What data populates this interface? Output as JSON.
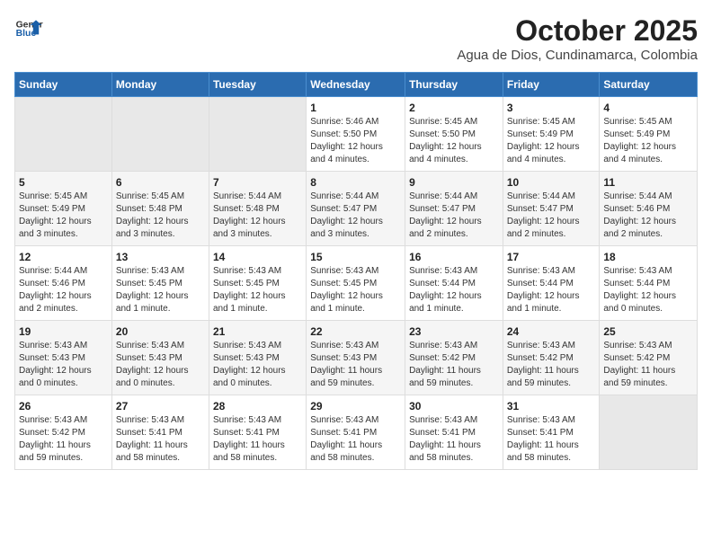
{
  "logo": {
    "general": "General",
    "blue": "Blue"
  },
  "title": "October 2025",
  "subtitle": "Agua de Dios, Cundinamarca, Colombia",
  "weekdays": [
    "Sunday",
    "Monday",
    "Tuesday",
    "Wednesday",
    "Thursday",
    "Friday",
    "Saturday"
  ],
  "weeks": [
    [
      {
        "day": "",
        "info": ""
      },
      {
        "day": "",
        "info": ""
      },
      {
        "day": "",
        "info": ""
      },
      {
        "day": "1",
        "info": "Sunrise: 5:46 AM\nSunset: 5:50 PM\nDaylight: 12 hours\nand 4 minutes."
      },
      {
        "day": "2",
        "info": "Sunrise: 5:45 AM\nSunset: 5:50 PM\nDaylight: 12 hours\nand 4 minutes."
      },
      {
        "day": "3",
        "info": "Sunrise: 5:45 AM\nSunset: 5:49 PM\nDaylight: 12 hours\nand 4 minutes."
      },
      {
        "day": "4",
        "info": "Sunrise: 5:45 AM\nSunset: 5:49 PM\nDaylight: 12 hours\nand 4 minutes."
      }
    ],
    [
      {
        "day": "5",
        "info": "Sunrise: 5:45 AM\nSunset: 5:49 PM\nDaylight: 12 hours\nand 3 minutes."
      },
      {
        "day": "6",
        "info": "Sunrise: 5:45 AM\nSunset: 5:48 PM\nDaylight: 12 hours\nand 3 minutes."
      },
      {
        "day": "7",
        "info": "Sunrise: 5:44 AM\nSunset: 5:48 PM\nDaylight: 12 hours\nand 3 minutes."
      },
      {
        "day": "8",
        "info": "Sunrise: 5:44 AM\nSunset: 5:47 PM\nDaylight: 12 hours\nand 3 minutes."
      },
      {
        "day": "9",
        "info": "Sunrise: 5:44 AM\nSunset: 5:47 PM\nDaylight: 12 hours\nand 2 minutes."
      },
      {
        "day": "10",
        "info": "Sunrise: 5:44 AM\nSunset: 5:47 PM\nDaylight: 12 hours\nand 2 minutes."
      },
      {
        "day": "11",
        "info": "Sunrise: 5:44 AM\nSunset: 5:46 PM\nDaylight: 12 hours\nand 2 minutes."
      }
    ],
    [
      {
        "day": "12",
        "info": "Sunrise: 5:44 AM\nSunset: 5:46 PM\nDaylight: 12 hours\nand 2 minutes."
      },
      {
        "day": "13",
        "info": "Sunrise: 5:43 AM\nSunset: 5:45 PM\nDaylight: 12 hours\nand 1 minute."
      },
      {
        "day": "14",
        "info": "Sunrise: 5:43 AM\nSunset: 5:45 PM\nDaylight: 12 hours\nand 1 minute."
      },
      {
        "day": "15",
        "info": "Sunrise: 5:43 AM\nSunset: 5:45 PM\nDaylight: 12 hours\nand 1 minute."
      },
      {
        "day": "16",
        "info": "Sunrise: 5:43 AM\nSunset: 5:44 PM\nDaylight: 12 hours\nand 1 minute."
      },
      {
        "day": "17",
        "info": "Sunrise: 5:43 AM\nSunset: 5:44 PM\nDaylight: 12 hours\nand 1 minute."
      },
      {
        "day": "18",
        "info": "Sunrise: 5:43 AM\nSunset: 5:44 PM\nDaylight: 12 hours\nand 0 minutes."
      }
    ],
    [
      {
        "day": "19",
        "info": "Sunrise: 5:43 AM\nSunset: 5:43 PM\nDaylight: 12 hours\nand 0 minutes."
      },
      {
        "day": "20",
        "info": "Sunrise: 5:43 AM\nSunset: 5:43 PM\nDaylight: 12 hours\nand 0 minutes."
      },
      {
        "day": "21",
        "info": "Sunrise: 5:43 AM\nSunset: 5:43 PM\nDaylight: 12 hours\nand 0 minutes."
      },
      {
        "day": "22",
        "info": "Sunrise: 5:43 AM\nSunset: 5:43 PM\nDaylight: 11 hours\nand 59 minutes."
      },
      {
        "day": "23",
        "info": "Sunrise: 5:43 AM\nSunset: 5:42 PM\nDaylight: 11 hours\nand 59 minutes."
      },
      {
        "day": "24",
        "info": "Sunrise: 5:43 AM\nSunset: 5:42 PM\nDaylight: 11 hours\nand 59 minutes."
      },
      {
        "day": "25",
        "info": "Sunrise: 5:43 AM\nSunset: 5:42 PM\nDaylight: 11 hours\nand 59 minutes."
      }
    ],
    [
      {
        "day": "26",
        "info": "Sunrise: 5:43 AM\nSunset: 5:42 PM\nDaylight: 11 hours\nand 59 minutes."
      },
      {
        "day": "27",
        "info": "Sunrise: 5:43 AM\nSunset: 5:41 PM\nDaylight: 11 hours\nand 58 minutes."
      },
      {
        "day": "28",
        "info": "Sunrise: 5:43 AM\nSunset: 5:41 PM\nDaylight: 11 hours\nand 58 minutes."
      },
      {
        "day": "29",
        "info": "Sunrise: 5:43 AM\nSunset: 5:41 PM\nDaylight: 11 hours\nand 58 minutes."
      },
      {
        "day": "30",
        "info": "Sunrise: 5:43 AM\nSunset: 5:41 PM\nDaylight: 11 hours\nand 58 minutes."
      },
      {
        "day": "31",
        "info": "Sunrise: 5:43 AM\nSunset: 5:41 PM\nDaylight: 11 hours\nand 58 minutes."
      },
      {
        "day": "",
        "info": ""
      }
    ]
  ]
}
